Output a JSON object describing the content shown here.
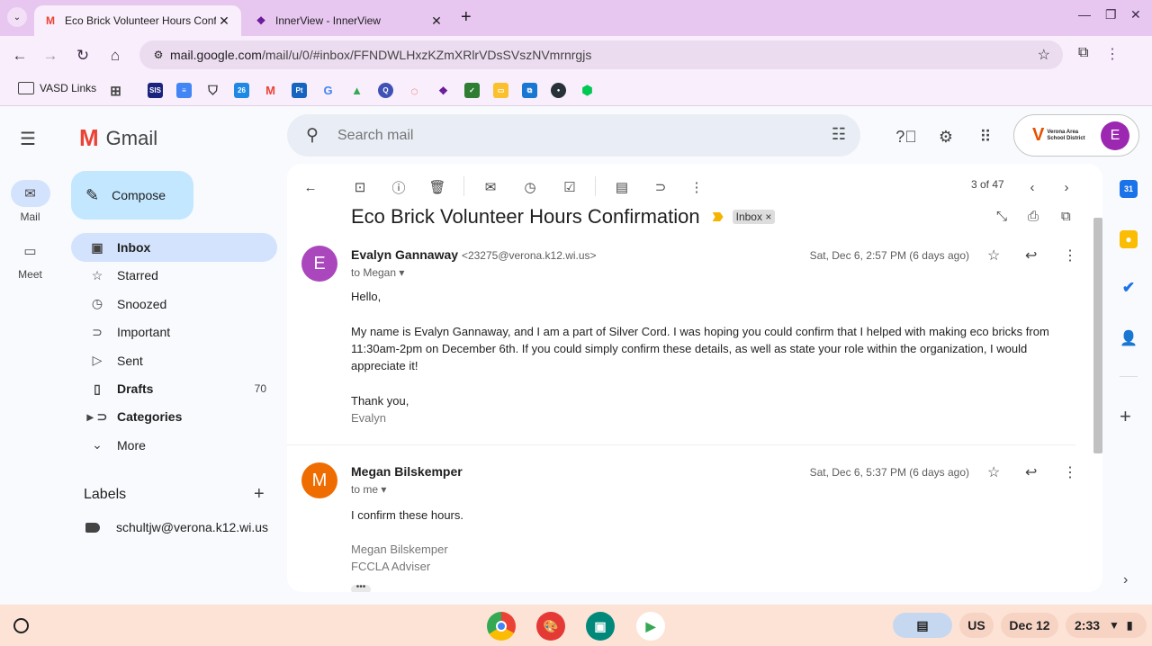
{
  "browser": {
    "tabs": [
      {
        "title": "Eco Brick Volunteer Hours Confirmation",
        "favicon": "gmail-icon",
        "active": true
      },
      {
        "title": "InnerView - InnerView",
        "favicon": "innerview-icon",
        "active": false
      }
    ],
    "url_host": "mail.google.com",
    "url_path": "/mail/u/0/#inbox/FFNDWLHxzKZmXRlrVDsSVszNVmrnrgjs",
    "bookmark_folder": "VASD Links",
    "bookmark_labels": [
      "SIS",
      "Pt"
    ]
  },
  "gmail": {
    "brand": "Gmail",
    "compose_label": "Compose",
    "rail": [
      {
        "label": "Mail",
        "icon": "mail-icon"
      },
      {
        "label": "Meet",
        "icon": "video-icon"
      }
    ],
    "nav": [
      {
        "label": "Inbox",
        "icon": "inbox-icon",
        "count": ""
      },
      {
        "label": "Starred",
        "icon": "star-icon",
        "count": ""
      },
      {
        "label": "Snoozed",
        "icon": "clock-icon",
        "count": ""
      },
      {
        "label": "Important",
        "icon": "important-icon",
        "count": ""
      },
      {
        "label": "Sent",
        "icon": "send-icon",
        "count": ""
      },
      {
        "label": "Drafts",
        "icon": "draft-icon",
        "count": "70"
      },
      {
        "label": "Categories",
        "icon": "label-icon",
        "count": ""
      },
      {
        "label": "More",
        "icon": "chevron-down-icon",
        "count": ""
      }
    ],
    "labels_header": "Labels",
    "labels": [
      "schultjw@verona.k12.wi.us"
    ],
    "search_placeholder": "Search mail",
    "school_name": "Verona Area School District",
    "account_initial": "E"
  },
  "thread": {
    "pager": "3 of 47",
    "subject": "Eco Brick Volunteer Hours Confirmation",
    "inbox_chip": "Inbox ×",
    "messages": [
      {
        "initial": "E",
        "avatar_color": "#ab47bc",
        "sender": "Evalyn Gannaway",
        "address": "<23275@verona.k12.wi.us>",
        "recipient": "to Megan",
        "date": "Sat, Dec 6, 2:57 PM (6 days ago)",
        "greeting": "Hello,",
        "body": "My name is Evalyn Gannaway, and I am a part of Silver Cord. I was hoping you could confirm that I helped with making eco bricks from 11:30am-2pm on December 6th. If you could simply confirm these details, as well as state your role within the organization, I would appreciate it!",
        "closing": "Thank you,",
        "signature": "Evalyn"
      },
      {
        "initial": "M",
        "avatar_color": "#ef6c00",
        "sender": "Megan Bilskemper",
        "recipient": "to me",
        "date": "Sat, Dec 6, 5:37 PM (6 days ago)",
        "body": "I confirm these hours.",
        "signature_name": "Megan Bilskemper",
        "signature_title": "FCCLA Adviser"
      }
    ]
  },
  "shelf": {
    "locale": "US",
    "date": "Dec 12",
    "time": "2:33"
  }
}
